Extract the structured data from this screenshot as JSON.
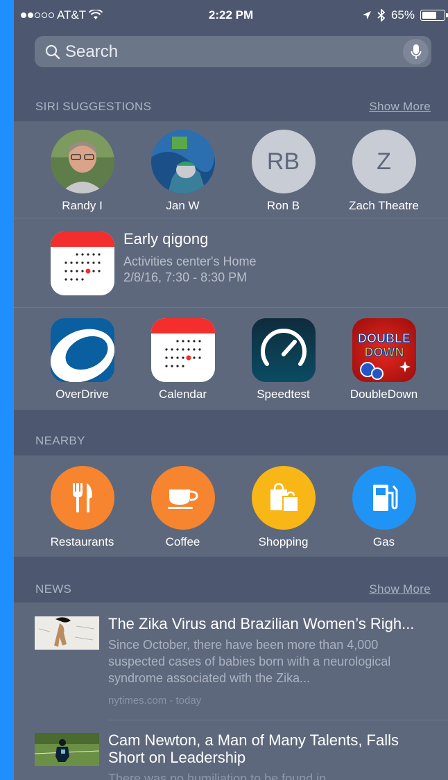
{
  "status": {
    "carrier": "AT&T",
    "time": "2:22 PM",
    "battery": "65%",
    "battery_level": 0.65,
    "signal_bars": 2,
    "signal_total": 5
  },
  "search": {
    "placeholder": "Search"
  },
  "siri": {
    "header": "SIRI SUGGESTIONS",
    "show_more": "Show More",
    "contacts": [
      {
        "name": "Randy I",
        "initials": ""
      },
      {
        "name": "Jan W",
        "initials": ""
      },
      {
        "name": "Ron B",
        "initials": "RB"
      },
      {
        "name": "Zach Theatre",
        "initials": "Z"
      }
    ],
    "event": {
      "title": "Early qigong",
      "location": "Activities center's Home",
      "time": "2/8/16, 7:30 - 8:30 PM"
    },
    "apps": [
      {
        "name": "OverDrive",
        "icon": "overdrive-icon"
      },
      {
        "name": "Calendar",
        "icon": "calendar-icon"
      },
      {
        "name": "Speedtest",
        "icon": "speedtest-icon"
      },
      {
        "name": "DoubleDown",
        "icon": "doubledown-icon",
        "logo_line1": "DOUBLE",
        "logo_line2": "DOWN"
      }
    ]
  },
  "nearby": {
    "header": "NEARBY",
    "items": [
      {
        "name": "Restaurants",
        "icon": "fork-knife-icon",
        "color": "#f7852f"
      },
      {
        "name": "Coffee",
        "icon": "coffee-cup-icon",
        "color": "#f7852f"
      },
      {
        "name": "Shopping",
        "icon": "shopping-bags-icon",
        "color": "#f8b617"
      },
      {
        "name": "Gas",
        "icon": "gas-pump-icon",
        "color": "#1f94f5"
      }
    ]
  },
  "news": {
    "header": "NEWS",
    "show_more": "Show More",
    "items": [
      {
        "title": "The Zika Virus and Brazilian Women’s Righ...",
        "description": "Since October, there have been more than 4,000 suspected cases of babies born with a neurological syndrome associated with the Zika...",
        "source": "nytimes.com - today"
      },
      {
        "title": "Cam Newton, a Man of Many Talents, Falls Short on Leadership",
        "description": "There was no humiliation to be found in"
      }
    ]
  }
}
